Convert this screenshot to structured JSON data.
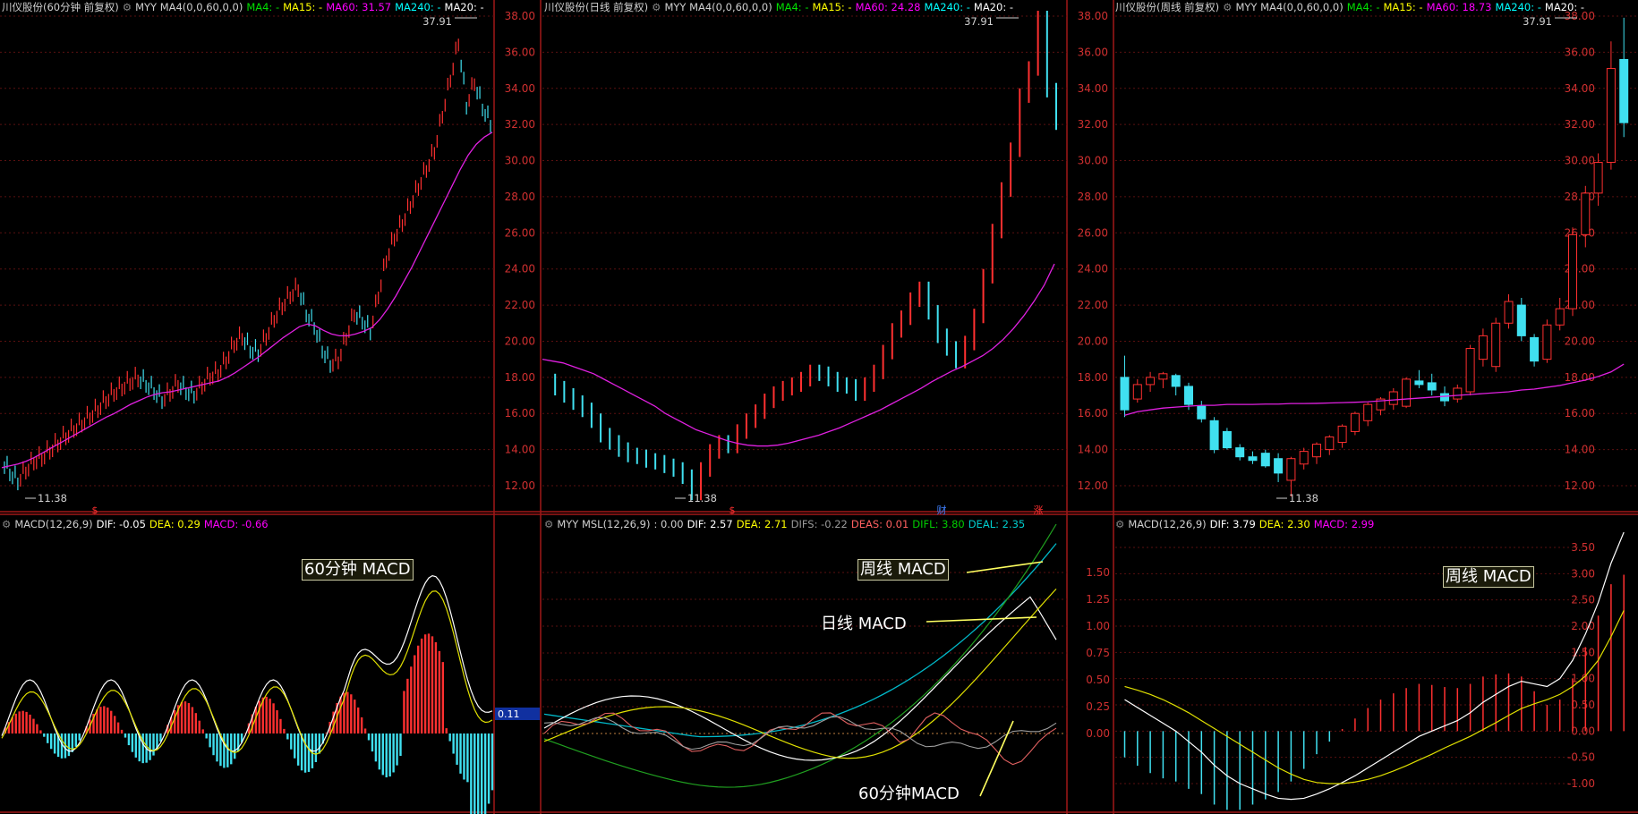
{
  "panels": [
    {
      "id": "p60",
      "title": "川仪股份(60分钟 前复权)",
      "indicator": "MYY MA4(0,0,60,0,0)",
      "ma": [
        {
          "label": "MA4: -",
          "color": "#00e000"
        },
        {
          "label": "MA15: -",
          "color": "#ffff00"
        },
        {
          "label": "MA60: 31.57",
          "color": "#ff00ff"
        },
        {
          "label": "MA240: -",
          "color": "#00ffff"
        },
        {
          "label": "MA20: -",
          "color": "#ffffff"
        }
      ],
      "price_ticks": [
        "38.00",
        "36.00",
        "34.00",
        "32.00",
        "30.00",
        "28.00",
        "26.00",
        "24.00",
        "22.00",
        "20.00",
        "18.00",
        "16.00",
        "14.00",
        "12.00"
      ],
      "high_label": "37.91",
      "low_label": "11.38",
      "macd_header": {
        "name": "MACD(12,26,9)",
        "dif": "DIF: -0.05",
        "dea": "DEA: 0.29",
        "macd": "MACD: -0.66"
      },
      "macd_badge": "0.11",
      "annotation": "60分钟 MACD"
    },
    {
      "id": "pday",
      "title": "川仪股份(日线 前复权)",
      "indicator": "MYY MA4(0,0,60,0,0)",
      "ma": [
        {
          "label": "MA4: -",
          "color": "#00e000"
        },
        {
          "label": "MA15: -",
          "color": "#ffff00"
        },
        {
          "label": "MA60: 24.28",
          "color": "#ff00ff"
        },
        {
          "label": "MA240: -",
          "color": "#00ffff"
        },
        {
          "label": "MA20: -",
          "color": "#ffffff"
        }
      ],
      "price_ticks": [
        "38.00",
        "36.00",
        "34.00",
        "32.00",
        "30.00",
        "28.00",
        "26.00",
        "24.00",
        "22.00",
        "20.00",
        "18.00",
        "16.00",
        "14.00",
        "12.00"
      ],
      "high_label": "37.91",
      "low_label": "11.38",
      "markers": [
        "$",
        "财",
        "涨"
      ],
      "macd_header": {
        "name": "MYY MSL(12,26,9)",
        "zero": ": 0.00",
        "dif": "DIF: 2.57",
        "dea": "DEA: 2.71",
        "difs": "DIFS: -0.22",
        "deas": "DEAS: 0.01",
        "difl": "DIFL: 3.80",
        "deal": "DEAL: 2.35"
      },
      "macd_ticks": [
        "1.50",
        "1.25",
        "1.00",
        "0.75",
        "0.50",
        "0.25",
        "0.00"
      ],
      "annotations": [
        "周线 MACD",
        "日线 MACD",
        "60分钟MACD"
      ]
    },
    {
      "id": "pweek",
      "title": "川仪股份(周线 前复权)",
      "indicator": "MYY MA4(0,0,60,0,0)",
      "ma": [
        {
          "label": "MA4: -",
          "color": "#00e000"
        },
        {
          "label": "MA15: -",
          "color": "#ffff00"
        },
        {
          "label": "MA60: 18.73",
          "color": "#ff00ff"
        },
        {
          "label": "MA240: -",
          "color": "#00ffff"
        },
        {
          "label": "MA20: -",
          "color": "#ffffff"
        }
      ],
      "price_ticks": [
        "38.00",
        "36.00",
        "34.00",
        "32.00",
        "30.00",
        "28.00",
        "26.00",
        "24.00",
        "22.00",
        "20.00",
        "18.00",
        "16.00",
        "14.00",
        "12.00"
      ],
      "high_label": "37.91",
      "low_label": "11.38",
      "macd_header": {
        "name": "MACD(12,26,9)",
        "dif": "DIF: 3.79",
        "dea": "DEA: 2.30",
        "macd": "MACD: 2.99"
      },
      "macd_ticks": [
        "3.50",
        "3.00",
        "2.50",
        "2.00",
        "1.50",
        "1.00",
        "0.50",
        "0.00",
        "-0.50",
        "-1.00"
      ],
      "annotation": "周线 MACD"
    }
  ],
  "chart_data": {
    "type": "line",
    "note_free": true,
    "weekly_candles": [
      {
        "o": 18.0,
        "h": 19.2,
        "l": 15.8,
        "c": 16.2
      },
      {
        "o": 16.8,
        "h": 17.9,
        "l": 16.6,
        "c": 17.6
      },
      {
        "o": 17.6,
        "h": 18.3,
        "l": 17.2,
        "c": 18.0
      },
      {
        "o": 17.9,
        "h": 18.3,
        "l": 17.4,
        "c": 18.2
      },
      {
        "o": 18.1,
        "h": 18.2,
        "l": 17.0,
        "c": 17.5
      },
      {
        "o": 17.5,
        "h": 17.7,
        "l": 16.2,
        "c": 16.5
      },
      {
        "o": 16.4,
        "h": 16.7,
        "l": 15.5,
        "c": 15.7
      },
      {
        "o": 15.6,
        "h": 15.8,
        "l": 13.8,
        "c": 14.0
      },
      {
        "o": 15.0,
        "h": 15.2,
        "l": 14.0,
        "c": 14.1
      },
      {
        "o": 14.1,
        "h": 14.3,
        "l": 13.4,
        "c": 13.6
      },
      {
        "o": 13.6,
        "h": 13.9,
        "l": 13.2,
        "c": 13.4
      },
      {
        "o": 13.8,
        "h": 14.0,
        "l": 13.0,
        "c": 13.1
      },
      {
        "o": 13.5,
        "h": 13.8,
        "l": 12.2,
        "c": 12.7
      },
      {
        "o": 12.3,
        "h": 13.6,
        "l": 11.4,
        "c": 13.5
      },
      {
        "o": 13.2,
        "h": 14.1,
        "l": 12.9,
        "c": 13.9
      },
      {
        "o": 13.6,
        "h": 14.4,
        "l": 13.2,
        "c": 14.3
      },
      {
        "o": 14.0,
        "h": 14.8,
        "l": 13.7,
        "c": 14.7
      },
      {
        "o": 14.4,
        "h": 15.4,
        "l": 14.1,
        "c": 15.3
      },
      {
        "o": 15.0,
        "h": 16.1,
        "l": 14.8,
        "c": 16.0
      },
      {
        "o": 15.6,
        "h": 16.6,
        "l": 15.3,
        "c": 16.5
      },
      {
        "o": 16.2,
        "h": 16.9,
        "l": 15.9,
        "c": 16.8
      },
      {
        "o": 16.5,
        "h": 17.4,
        "l": 16.2,
        "c": 17.2
      },
      {
        "o": 16.4,
        "h": 18.0,
        "l": 16.3,
        "c": 17.9
      },
      {
        "o": 17.8,
        "h": 18.4,
        "l": 17.4,
        "c": 17.6
      },
      {
        "o": 17.7,
        "h": 18.2,
        "l": 17.0,
        "c": 17.3
      },
      {
        "o": 17.1,
        "h": 17.5,
        "l": 16.4,
        "c": 16.7
      },
      {
        "o": 16.8,
        "h": 17.6,
        "l": 16.6,
        "c": 17.4
      },
      {
        "o": 17.2,
        "h": 19.8,
        "l": 17.0,
        "c": 19.6
      },
      {
        "o": 19.0,
        "h": 20.7,
        "l": 18.6,
        "c": 20.3
      },
      {
        "o": 18.6,
        "h": 21.3,
        "l": 18.3,
        "c": 21.0
      },
      {
        "o": 21.0,
        "h": 22.6,
        "l": 20.7,
        "c": 22.2
      },
      {
        "o": 22.0,
        "h": 22.4,
        "l": 20.0,
        "c": 20.3
      },
      {
        "o": 20.2,
        "h": 20.4,
        "l": 18.6,
        "c": 18.9
      },
      {
        "o": 19.0,
        "h": 21.2,
        "l": 18.8,
        "c": 20.9
      },
      {
        "o": 20.9,
        "h": 22.4,
        "l": 20.6,
        "c": 21.8
      },
      {
        "o": 21.8,
        "h": 26.3,
        "l": 21.4,
        "c": 25.9
      },
      {
        "o": 25.9,
        "h": 28.6,
        "l": 25.2,
        "c": 28.2
      },
      {
        "o": 28.2,
        "h": 30.4,
        "l": 27.5,
        "c": 29.9
      },
      {
        "o": 29.9,
        "h": 36.6,
        "l": 29.5,
        "c": 35.1
      },
      {
        "o": 35.6,
        "h": 37.91,
        "l": 31.3,
        "c": 32.1
      }
    ],
    "weekly_ma60": [
      15.9,
      16.1,
      16.2,
      16.3,
      16.35,
      16.4,
      16.45,
      16.45,
      16.5,
      16.5,
      16.5,
      16.52,
      16.52,
      16.55,
      16.55,
      16.56,
      16.58,
      16.6,
      16.62,
      16.65,
      16.7,
      16.75,
      16.8,
      16.85,
      16.9,
      16.95,
      17.0,
      17.05,
      17.1,
      17.15,
      17.2,
      17.3,
      17.35,
      17.45,
      17.55,
      17.7,
      17.85,
      18.05,
      18.3,
      18.73
    ],
    "weekly_dif": [
      0.6,
      0.45,
      0.3,
      0.15,
      0.0,
      -0.2,
      -0.4,
      -0.65,
      -0.85,
      -1.0,
      -1.1,
      -1.2,
      -1.28,
      -1.3,
      -1.28,
      -1.2,
      -1.1,
      -0.98,
      -0.85,
      -0.7,
      -0.55,
      -0.4,
      -0.25,
      -0.1,
      0.0,
      0.1,
      0.2,
      0.35,
      0.55,
      0.7,
      0.85,
      0.95,
      0.9,
      0.85,
      1.0,
      1.35,
      1.85,
      2.45,
      3.2,
      3.79
    ],
    "weekly_dea": [
      0.85,
      0.78,
      0.7,
      0.6,
      0.48,
      0.35,
      0.2,
      0.05,
      -0.1,
      -0.25,
      -0.4,
      -0.55,
      -0.7,
      -0.82,
      -0.92,
      -0.98,
      -1.0,
      -1.0,
      -0.97,
      -0.92,
      -0.85,
      -0.76,
      -0.66,
      -0.55,
      -0.44,
      -0.32,
      -0.21,
      -0.1,
      0.03,
      0.16,
      0.3,
      0.43,
      0.52,
      0.6,
      0.7,
      0.85,
      1.05,
      1.35,
      1.8,
      2.3
    ],
    "day_ma60": [
      19.0,
      18.9,
      18.8,
      18.6,
      18.4,
      18.2,
      17.9,
      17.6,
      17.3,
      17.0,
      16.7,
      16.4,
      16.0,
      15.7,
      15.4,
      15.1,
      14.9,
      14.7,
      14.5,
      14.35,
      14.25,
      14.2,
      14.2,
      14.25,
      14.35,
      14.5,
      14.65,
      14.8,
      15.0,
      15.2,
      15.45,
      15.7,
      15.95,
      16.2,
      16.5,
      16.8,
      17.1,
      17.4,
      17.75,
      18.05,
      18.35,
      18.6,
      18.9,
      19.2,
      19.6,
      20.1,
      20.7,
      21.4,
      22.2,
      23.1,
      24.28
    ],
    "day_close": [
      17.8,
      17.4,
      17.0,
      16.6,
      16.2,
      15.6,
      14.8,
      14.4,
      14.0,
      13.7,
      13.6,
      13.4,
      13.3,
      13.1,
      12.9,
      12.5,
      11.6,
      12.9,
      13.9,
      14.4,
      14.2,
      15.0,
      15.6,
      16.1,
      16.7,
      17.1,
      17.4,
      17.6,
      17.9,
      18.3,
      18.2,
      17.9,
      17.6,
      17.5,
      17.1,
      17.6,
      18.3,
      19.4,
      20.6,
      21.3,
      22.3,
      22.9,
      21.6,
      20.3,
      19.6,
      18.9,
      19.9,
      21.4,
      23.6,
      26.1,
      28.4,
      30.6,
      33.6,
      35.1,
      37.9,
      33.9,
      32.1
    ],
    "hour_close": [
      13.4,
      12.8,
      12.3,
      12.9,
      13.4,
      13.6,
      14.0,
      14.4,
      14.8,
      15.2,
      15.5,
      15.9,
      16.3,
      16.8,
      17.2,
      17.5,
      17.8,
      18.0,
      17.7,
      17.3,
      16.8,
      17.2,
      17.7,
      17.3,
      17.1,
      17.6,
      18.1,
      18.3,
      19.0,
      19.9,
      20.3,
      19.6,
      19.4,
      20.3,
      21.3,
      22.0,
      22.6,
      23.0,
      21.6,
      20.9,
      19.6,
      18.8,
      19.0,
      20.3,
      21.6,
      21.2,
      20.6,
      22.6,
      24.6,
      25.8,
      26.6,
      27.6,
      28.6,
      29.6,
      30.6,
      32.6,
      34.6,
      36.6,
      33.1,
      34.4,
      33.0,
      32.1
    ],
    "hour_ma60": [
      13.0,
      13.1,
      13.2,
      13.35,
      13.55,
      13.8,
      14.05,
      14.3,
      14.55,
      14.8,
      15.05,
      15.3,
      15.55,
      15.8,
      16.0,
      16.25,
      16.5,
      16.7,
      16.9,
      17.05,
      17.15,
      17.2,
      17.3,
      17.4,
      17.5,
      17.6,
      17.7,
      17.8,
      18.0,
      18.25,
      18.55,
      18.85,
      19.15,
      19.5,
      19.85,
      20.2,
      20.5,
      20.8,
      20.95,
      20.85,
      20.6,
      20.4,
      20.3,
      20.3,
      20.4,
      20.55,
      20.75,
      21.2,
      21.8,
      22.5,
      23.3,
      24.1,
      25.0,
      25.9,
      26.8,
      27.7,
      28.6,
      29.5,
      30.3,
      30.9,
      31.3,
      31.57
    ]
  }
}
